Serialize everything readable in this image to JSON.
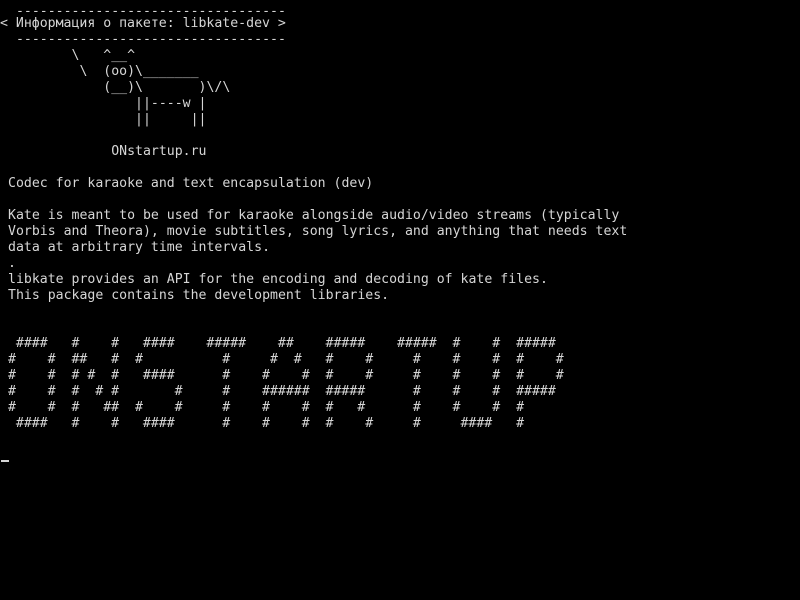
{
  "screen": {
    "background": "#000000",
    "foreground": "#d6d6d6"
  },
  "cowsay": {
    "border_top": " ----------------------------------",
    "message": "< Информация о пакете: libkate-dev >",
    "border_bottom": " ----------------------------------",
    "cow": [
      "        \\   ^__^",
      "         \\  (oo)\\_______",
      "            (__)\\       )\\/\\",
      "                ||----w |",
      "                ||     ||"
    ]
  },
  "site": "             ONstartup.ru",
  "package": {
    "summary": "Codec for karaoke and text encapsulation (dev)",
    "description": [
      "Kate is meant to be used for karaoke alongside audio/video streams (typically",
      "Vorbis and Theora), movie subtitles, song lyrics, and anything that needs text",
      "data at arbitrary time intervals.",
      ".",
      "libkate provides an API for the encoding and decoding of kate files.",
      "This package contains the development libraries."
    ]
  },
  "banner": [
    "  ####   #    #   ####    #####    ##    #####    #####  #    #  #####",
    " #    #  ##   #  #          #     #  #   #    #     #    #    #  #    #",
    " #    #  # #  #   ####      #    #    #  #    #     #    #    #  #    #",
    " #    #  #  # #       #     #    ######  #####      #    #    #  #####",
    " #    #  #   ##  #    #     #    #    #  #   #      #    #    #  #",
    "  ####   #    #   ####      #    #    #  #    #     #     ####   #"
  ]
}
